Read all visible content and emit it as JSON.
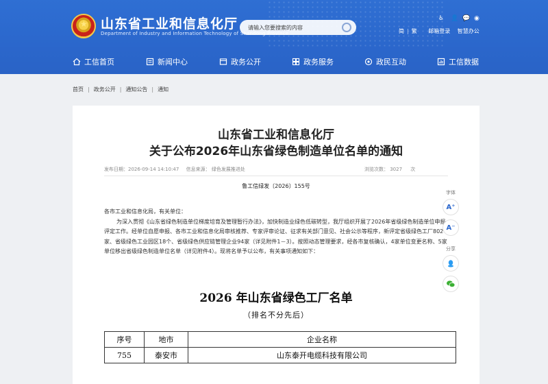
{
  "header": {
    "site_title": "山东省工业和信息化厅",
    "site_subtitle": "Department of Industry and Information Technology of Shandong Province",
    "search_placeholder": "请输入您要搜索的内容",
    "top_links": [
      "简",
      "繁",
      "邮箱登录",
      "智慧办公"
    ],
    "top_icons": [
      "accessibility-icon",
      "elder-mode-icon",
      "wechat-icon",
      "weibo-icon"
    ]
  },
  "nav": {
    "items": [
      {
        "label": "工信首页",
        "icon": "home-icon"
      },
      {
        "label": "新闻中心",
        "icon": "news-icon"
      },
      {
        "label": "政务公开",
        "icon": "open-gov-icon"
      },
      {
        "label": "政务服务",
        "icon": "service-icon"
      },
      {
        "label": "政民互动",
        "icon": "interaction-icon"
      },
      {
        "label": "工信数据",
        "icon": "data-icon"
      }
    ]
  },
  "breadcrumb": [
    "首页",
    "政务公开",
    "通知公告",
    "通知"
  ],
  "article": {
    "title_line1": "山东省工业和信息化厅",
    "title_line2": "关于公布2026年山东省绿色制造单位名单的通知",
    "publish_date": "发布日期：2026-09-14 14:10:47",
    "source": "信息来源： 绿色发展推进处",
    "views": "浏览次数： 3027",
    "views_unit": "次",
    "doc_number": "鲁工信绿发〔2026〕155号",
    "salutation": "各市工业和信息化局，有关单位：",
    "paragraph": "为深入贯彻《山东省绿色制造单位梯度培育及管理暂行办法》，加快制造业绿色低碳转型，我厅组织开展了2026年省级绿色制造单位申报评定工作。经单位自愿申报、各市工业和信息化局审核推荐、专家评审论证、征求有关部门意见、社会公示等程序，新评定省级绿色工厂802家、省级绿色工业园区18个、省级绿色供应链管理企业94家（详见附件1－3）。按照动态管理要求，经各市复核确认，4家单位变更名称、5家单位移出省级绿色制造单位名单（详见附件4）。现将名单予以公布，有关事项通知如下：",
    "list_title": "2026 年山东省绿色工厂名单",
    "list_subtitle": "（排名不分先后）",
    "table": {
      "headers": [
        "序号",
        "地市",
        "企业名称"
      ],
      "rows": [
        [
          "755",
          "泰安市",
          "山东泰开电缆科技有限公司"
        ]
      ]
    }
  },
  "side_tools": {
    "font_label": "字体",
    "font_increase": "A⁺",
    "font_decrease": "A⁻",
    "share_label": "分享",
    "share_icons": [
      "qq-share-icon",
      "wechat-share-icon"
    ]
  },
  "colors": {
    "header_blue": "#2b67cc",
    "page_bg": "#eef0f3"
  }
}
